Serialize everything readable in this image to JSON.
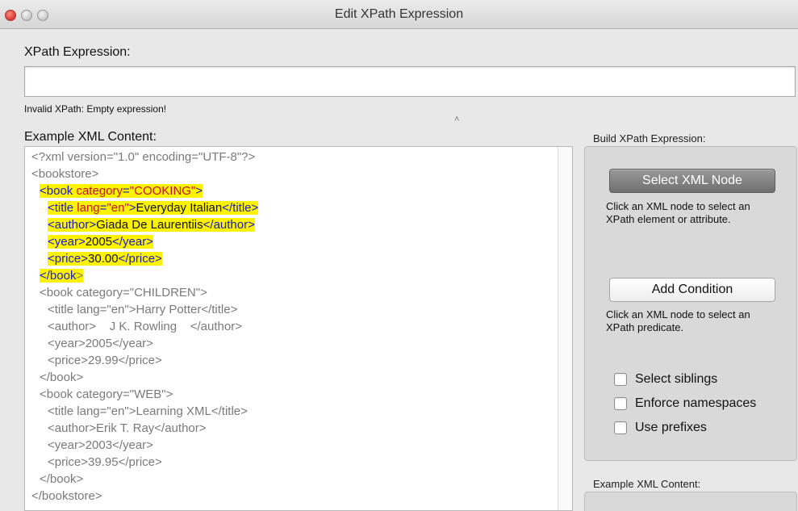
{
  "window": {
    "title": "Edit XPath Expression"
  },
  "xpath": {
    "label": "XPath Expression:",
    "value": "",
    "error": "Invalid XPath: Empty expression!"
  },
  "example": {
    "label": "Example XML Content:"
  },
  "xml_lines": [
    {
      "text": "<?xml version=\"1.0\" encoding=\"UTF-8\"?>",
      "indent": 0,
      "highlighted": false
    },
    {
      "text": "<bookstore>",
      "indent": 0,
      "highlighted": false
    },
    {
      "indent": 1,
      "highlighted": true,
      "parts": [
        {
          "t": "<book ",
          "c": "tag"
        },
        {
          "t": "category",
          "c": "attr"
        },
        {
          "t": "=",
          "c": "tag"
        },
        {
          "t": "\"COOKING\"",
          "c": "attr"
        },
        {
          "t": ">",
          "c": "tag"
        }
      ]
    },
    {
      "indent": 2,
      "highlighted": true,
      "parts": [
        {
          "t": "<title ",
          "c": "tag"
        },
        {
          "t": "lang",
          "c": "attr"
        },
        {
          "t": "=",
          "c": "tag"
        },
        {
          "t": "\"en\"",
          "c": "attr"
        },
        {
          "t": ">",
          "c": "tag"
        },
        {
          "t": "Everyday Italian",
          "c": "txt"
        },
        {
          "t": "</title>",
          "c": "tag"
        }
      ]
    },
    {
      "indent": 2,
      "highlighted": true,
      "parts": [
        {
          "t": "<author>",
          "c": "tag"
        },
        {
          "t": "Giada De Laurentiis",
          "c": "txt"
        },
        {
          "t": "</author>",
          "c": "tag"
        }
      ]
    },
    {
      "indent": 2,
      "highlighted": true,
      "parts": [
        {
          "t": "<year>",
          "c": "tag"
        },
        {
          "t": "2005",
          "c": "txt"
        },
        {
          "t": "</year>",
          "c": "tag"
        }
      ]
    },
    {
      "indent": 2,
      "highlighted": true,
      "parts": [
        {
          "t": "<price>",
          "c": "tag"
        },
        {
          "t": "30.00",
          "c": "txt"
        },
        {
          "t": "</price>",
          "c": "tag"
        }
      ]
    },
    {
      "indent": 1,
      "highlighted": true,
      "parts": [
        {
          "t": "</book",
          "c": "tag"
        },
        {
          "t": ">",
          "c": "dim"
        }
      ]
    },
    {
      "text": "<book category=\"CHILDREN\">",
      "indent": 1,
      "highlighted": false
    },
    {
      "text": "<title lang=\"en\">Harry Potter</title>",
      "indent": 2,
      "highlighted": false
    },
    {
      "text": "<author>    J K. Rowling    </author>",
      "indent": 2,
      "highlighted": false
    },
    {
      "text": "<year>2005</year>",
      "indent": 2,
      "highlighted": false
    },
    {
      "text": "<price>29.99</price>",
      "indent": 2,
      "highlighted": false
    },
    {
      "text": "</book>",
      "indent": 1,
      "highlighted": false
    },
    {
      "text": "<book category=\"WEB\">",
      "indent": 1,
      "highlighted": false
    },
    {
      "text": "<title lang=\"en\">Learning XML</title>",
      "indent": 2,
      "highlighted": false
    },
    {
      "text": "<author>Erik T. Ray</author>",
      "indent": 2,
      "highlighted": false
    },
    {
      "text": "<year>2003</year>",
      "indent": 2,
      "highlighted": false
    },
    {
      "text": "<price>39.95</price>",
      "indent": 2,
      "highlighted": false
    },
    {
      "text": "</book>",
      "indent": 1,
      "highlighted": false
    },
    {
      "text": "</bookstore>",
      "indent": 0,
      "highlighted": false
    }
  ],
  "build": {
    "label": "Build XPath Expression:",
    "select_button": "Select XML Node",
    "select_help": "Click an XML node to select an XPath element or attribute.",
    "add_button": "Add Condition",
    "add_help": "Click an XML node to select an XPath predicate.",
    "checkboxes": [
      {
        "label": "Select siblings",
        "checked": false
      },
      {
        "label": "Enforce namespaces",
        "checked": false
      },
      {
        "label": "Use prefixes",
        "checked": false
      }
    ]
  },
  "example_panel": {
    "label": "Example XML Content:"
  },
  "colors": {
    "highlight": "#fdf200",
    "tag": "#1a1ac8",
    "attr": "#c8102e",
    "plain": "#7a7a7a"
  }
}
